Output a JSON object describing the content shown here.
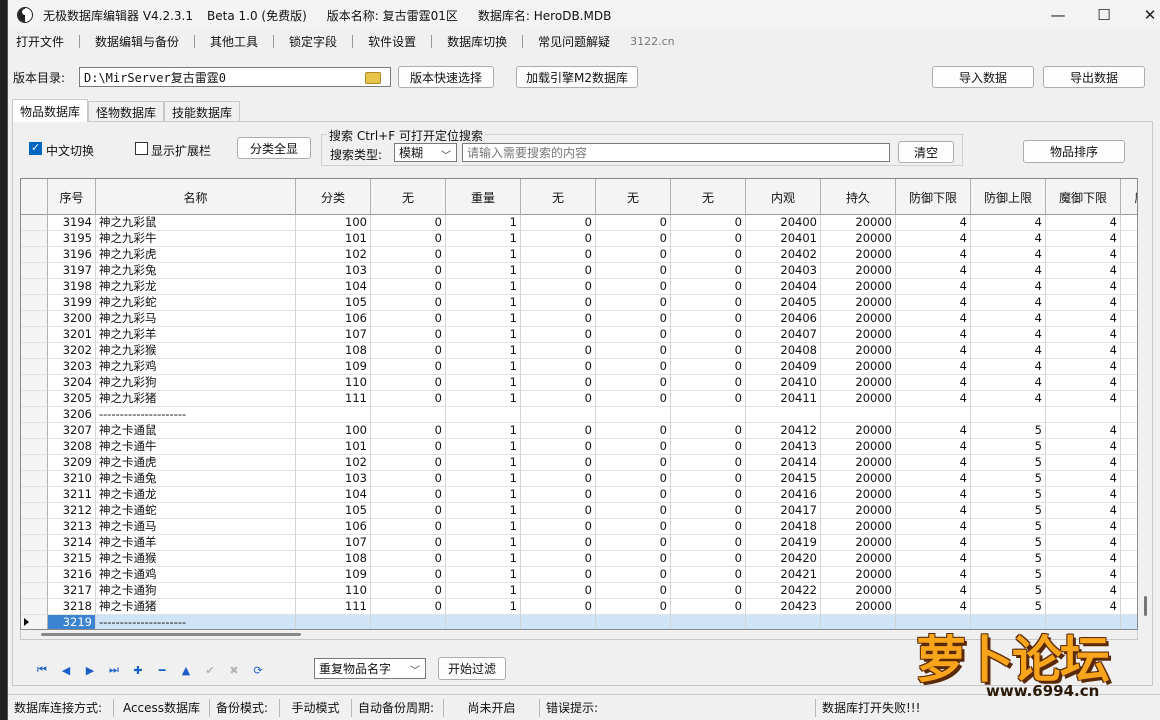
{
  "titlebar": {
    "app_name": "无极数据库编辑器 V4.2.3.1",
    "edition": "Beta 1.0 (免费版)",
    "version_name": "版本名称: 复古雷霆01区",
    "db_name": "数据库名: HeroDB.MDB",
    "minimize": "—",
    "maximize": "☐",
    "close": "✕"
  },
  "menu": {
    "items": [
      "打开文件",
      "数据编辑与备份",
      "其他工具",
      "锁定字段",
      "软件设置",
      "数据库切换",
      "常见问题解疑"
    ],
    "url": "3122.cn"
  },
  "toolbar": {
    "dir_label": "版本目录:",
    "dir_value": "D:\\MirServer复古雷霆0",
    "quick_select": "版本快速选择",
    "load_engine": "加载引擎M2数据库",
    "import": "导入数据",
    "export": "导出数据"
  },
  "tabs": [
    "物品数据库",
    "怪物数据库",
    "技能数据库"
  ],
  "options": {
    "chinese_switch": "中文切换",
    "show_ext": "显示扩展栏",
    "show_all": "分类全显",
    "search_group": "搜索  Ctrl+F 可打开定位搜索",
    "search_type_label": "搜索类型:",
    "search_type_value": "模糊",
    "search_placeholder": "请输入需要搜索的内容",
    "clear": "清空",
    "sort": "物品排序"
  },
  "grid": {
    "columns": [
      "序号",
      "名称",
      "分类",
      "无",
      "重量",
      "无",
      "无",
      "无",
      "内观",
      "持久",
      "防御下限",
      "防御上限",
      "魔御下限",
      "魔"
    ],
    "rows": [
      [
        "3194",
        "神之九彩鼠",
        "100",
        "0",
        "1",
        "0",
        "0",
        "0",
        "20400",
        "20000",
        "4",
        "4",
        "4"
      ],
      [
        "3195",
        "神之九彩牛",
        "101",
        "0",
        "1",
        "0",
        "0",
        "0",
        "20401",
        "20000",
        "4",
        "4",
        "4"
      ],
      [
        "3196",
        "神之九彩虎",
        "102",
        "0",
        "1",
        "0",
        "0",
        "0",
        "20402",
        "20000",
        "4",
        "4",
        "4"
      ],
      [
        "3197",
        "神之九彩兔",
        "103",
        "0",
        "1",
        "0",
        "0",
        "0",
        "20403",
        "20000",
        "4",
        "4",
        "4"
      ],
      [
        "3198",
        "神之九彩龙",
        "104",
        "0",
        "1",
        "0",
        "0",
        "0",
        "20404",
        "20000",
        "4",
        "4",
        "4"
      ],
      [
        "3199",
        "神之九彩蛇",
        "105",
        "0",
        "1",
        "0",
        "0",
        "0",
        "20405",
        "20000",
        "4",
        "4",
        "4"
      ],
      [
        "3200",
        "神之九彩马",
        "106",
        "0",
        "1",
        "0",
        "0",
        "0",
        "20406",
        "20000",
        "4",
        "4",
        "4"
      ],
      [
        "3201",
        "神之九彩羊",
        "107",
        "0",
        "1",
        "0",
        "0",
        "0",
        "20407",
        "20000",
        "4",
        "4",
        "4"
      ],
      [
        "3202",
        "神之九彩猴",
        "108",
        "0",
        "1",
        "0",
        "0",
        "0",
        "20408",
        "20000",
        "4",
        "4",
        "4"
      ],
      [
        "3203",
        "神之九彩鸡",
        "109",
        "0",
        "1",
        "0",
        "0",
        "0",
        "20409",
        "20000",
        "4",
        "4",
        "4"
      ],
      [
        "3204",
        "神之九彩狗",
        "110",
        "0",
        "1",
        "0",
        "0",
        "0",
        "20410",
        "20000",
        "4",
        "4",
        "4"
      ],
      [
        "3205",
        "神之九彩猪",
        "111",
        "0",
        "1",
        "0",
        "0",
        "0",
        "20411",
        "20000",
        "4",
        "4",
        "4"
      ],
      [
        "3206",
        "---------------------",
        "",
        "",
        "",
        "",
        "",
        "",
        "",
        "",
        "",
        "",
        ""
      ],
      [
        "3207",
        "神之卡通鼠",
        "100",
        "0",
        "1",
        "0",
        "0",
        "0",
        "20412",
        "20000",
        "4",
        "5",
        "4"
      ],
      [
        "3208",
        "神之卡通牛",
        "101",
        "0",
        "1",
        "0",
        "0",
        "0",
        "20413",
        "20000",
        "4",
        "5",
        "4"
      ],
      [
        "3209",
        "神之卡通虎",
        "102",
        "0",
        "1",
        "0",
        "0",
        "0",
        "20414",
        "20000",
        "4",
        "5",
        "4"
      ],
      [
        "3210",
        "神之卡通兔",
        "103",
        "0",
        "1",
        "0",
        "0",
        "0",
        "20415",
        "20000",
        "4",
        "5",
        "4"
      ],
      [
        "3211",
        "神之卡通龙",
        "104",
        "0",
        "1",
        "0",
        "0",
        "0",
        "20416",
        "20000",
        "4",
        "5",
        "4"
      ],
      [
        "3212",
        "神之卡通蛇",
        "105",
        "0",
        "1",
        "0",
        "0",
        "0",
        "20417",
        "20000",
        "4",
        "5",
        "4"
      ],
      [
        "3213",
        "神之卡通马",
        "106",
        "0",
        "1",
        "0",
        "0",
        "0",
        "20418",
        "20000",
        "4",
        "5",
        "4"
      ],
      [
        "3214",
        "神之卡通羊",
        "107",
        "0",
        "1",
        "0",
        "0",
        "0",
        "20419",
        "20000",
        "4",
        "5",
        "4"
      ],
      [
        "3215",
        "神之卡通猴",
        "108",
        "0",
        "1",
        "0",
        "0",
        "0",
        "20420",
        "20000",
        "4",
        "5",
        "4"
      ],
      [
        "3216",
        "神之卡通鸡",
        "109",
        "0",
        "1",
        "0",
        "0",
        "0",
        "20421",
        "20000",
        "4",
        "5",
        "4"
      ],
      [
        "3217",
        "神之卡通狗",
        "110",
        "0",
        "1",
        "0",
        "0",
        "0",
        "20422",
        "20000",
        "4",
        "5",
        "4"
      ],
      [
        "3218",
        "神之卡通猪",
        "111",
        "0",
        "1",
        "0",
        "0",
        "0",
        "20423",
        "20000",
        "4",
        "5",
        "4"
      ],
      [
        "3219",
        "---------------------",
        "",
        "",
        "",
        "",
        "",
        "",
        "",
        "",
        "",
        "",
        ""
      ]
    ],
    "selected_id": "3219"
  },
  "navigator": {
    "buttons": [
      {
        "name": "first-record-icon",
        "glyph": "⏮"
      },
      {
        "name": "prior-record-icon",
        "glyph": "◀"
      },
      {
        "name": "next-record-icon",
        "glyph": "▶"
      },
      {
        "name": "last-record-icon",
        "glyph": "⏭"
      },
      {
        "name": "insert-record-icon",
        "glyph": "✚"
      },
      {
        "name": "delete-record-icon",
        "glyph": "━"
      },
      {
        "name": "edit-record-icon",
        "glyph": "▲"
      },
      {
        "name": "post-record-icon",
        "glyph": "✔"
      },
      {
        "name": "cancel-record-icon",
        "glyph": "✖"
      },
      {
        "name": "refresh-record-icon",
        "glyph": "⟳"
      }
    ],
    "filter_select": "重复物品名字",
    "filter_button": "开始过滤"
  },
  "status": {
    "conn_label": "数据库连接方式:",
    "conn_value": "Access数据库",
    "backup_label": "备份模式:",
    "backup_value": "手动模式",
    "auto_label": "自动备份周期:",
    "auto_value": "尚未开启",
    "error_label": "错误提示:",
    "error_value": "数据库打开失败!!!"
  },
  "watermark": {
    "text": "萝卜论坛",
    "url": "www.6994.cn"
  }
}
